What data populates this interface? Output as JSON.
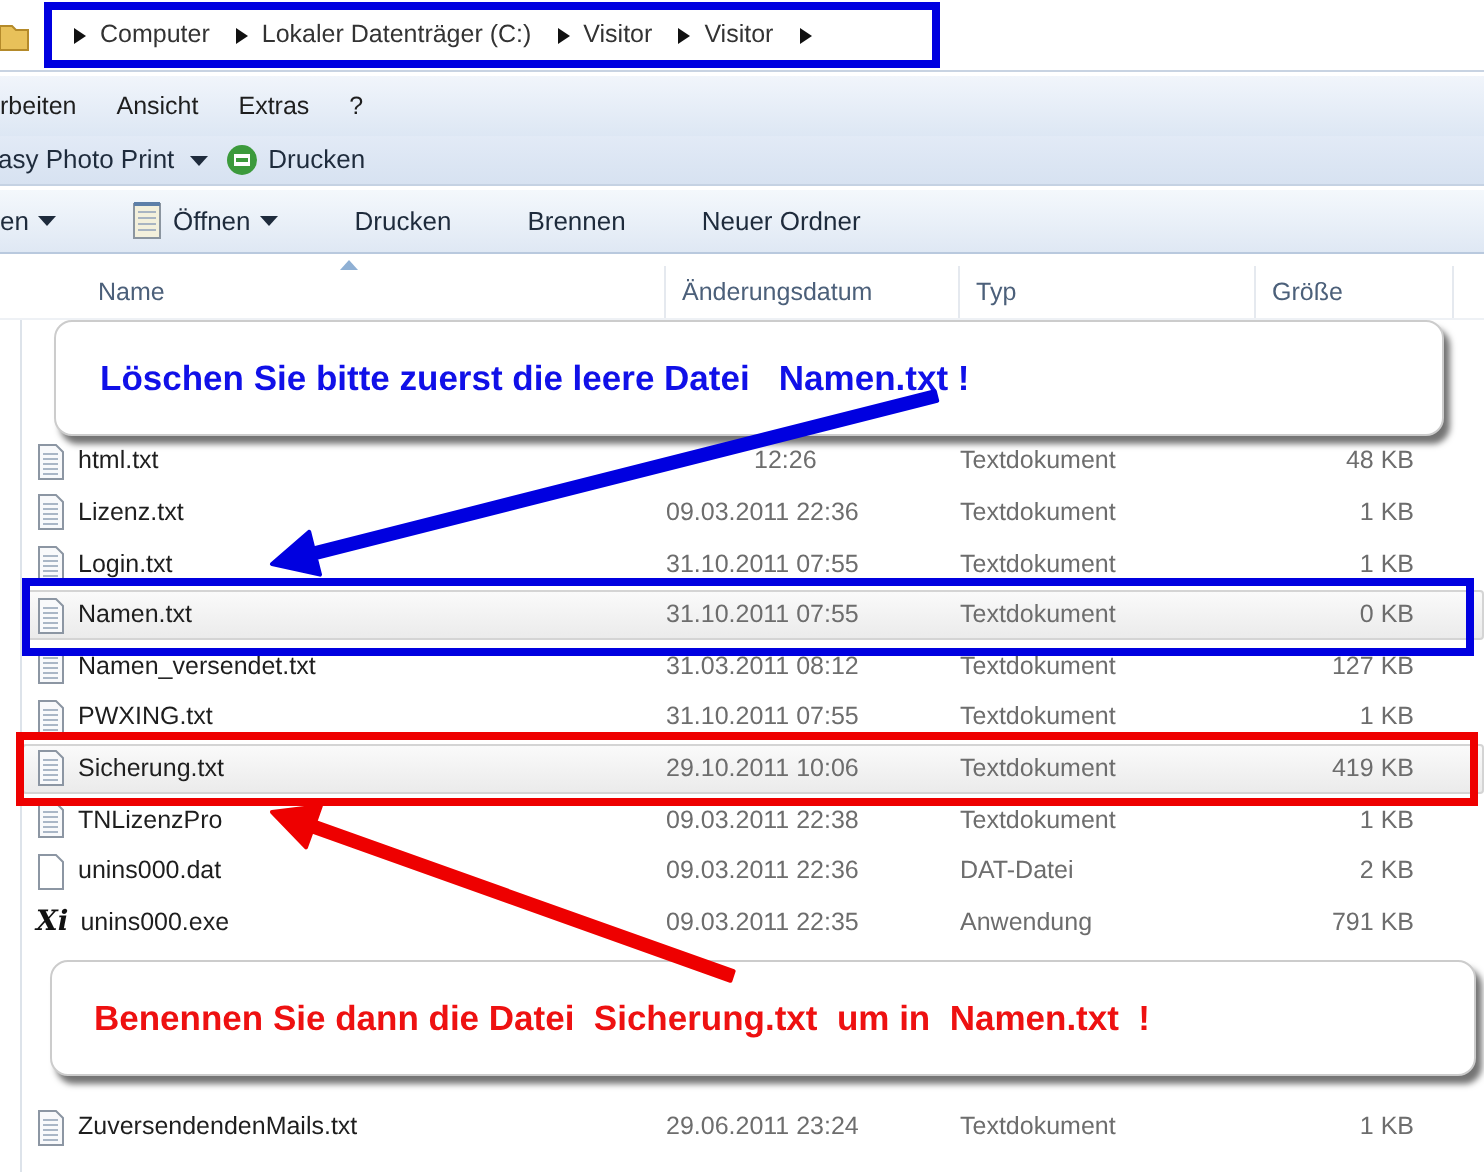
{
  "address_bar": {
    "crumbs": [
      "Computer",
      "Lokaler Datenträger (C:)",
      "Visitor",
      "Visitor"
    ]
  },
  "menu_bar": [
    "rbeiten",
    "Ansicht",
    "Extras",
    "?"
  ],
  "plugin_bar": [
    {
      "label": "asy Photo Print",
      "kind": "dropdown"
    },
    {
      "label": "Drucken",
      "kind": "print"
    }
  ],
  "command_bar": [
    {
      "label": "en",
      "dropdown": true,
      "kind": "plain"
    },
    {
      "label": "Öffnen",
      "dropdown": true,
      "kind": "notepad"
    },
    {
      "label": "Drucken",
      "dropdown": false,
      "kind": "plain"
    },
    {
      "label": "Brennen",
      "dropdown": false,
      "kind": "plain"
    },
    {
      "label": "Neuer Ordner",
      "dropdown": false,
      "kind": "plain"
    }
  ],
  "columns": [
    {
      "label": "Name",
      "sorted": true
    },
    {
      "label": "Änderungsdatum",
      "sorted": false
    },
    {
      "label": "Typ",
      "sorted": false
    },
    {
      "label": "Größe",
      "sorted": false
    }
  ],
  "rows": [
    {
      "name": "html.txt",
      "date": "12:26",
      "type": "Textdokument",
      "size": "48 KB",
      "kind": "text",
      "highlighted": false
    },
    {
      "name": "Lizenz.txt",
      "date": "09.03.2011 22:36",
      "type": "Textdokument",
      "size": "1 KB",
      "kind": "text",
      "highlighted": false
    },
    {
      "name": "Login.txt",
      "date": "31.10.2011 07:55",
      "type": "Textdokument",
      "size": "1 KB",
      "kind": "text",
      "highlighted": false
    },
    {
      "name": "Namen.txt",
      "date": "31.10.2011 07:55",
      "type": "Textdokument",
      "size": "0 KB",
      "kind": "text",
      "highlighted": true
    },
    {
      "name": "Namen_versendet.txt",
      "date": "31.03.2011 08:12",
      "type": "Textdokument",
      "size": "127 KB",
      "kind": "text",
      "highlighted": false
    },
    {
      "name": "PWXING.txt",
      "date": "31.10.2011 07:55",
      "type": "Textdokument",
      "size": "1 KB",
      "kind": "text",
      "highlighted": false
    },
    {
      "name": "Sicherung.txt",
      "date": "29.10.2011 10:06",
      "type": "Textdokument",
      "size": "419 KB",
      "kind": "text",
      "highlighted": true
    },
    {
      "name": "TNLizenzPro",
      "date": "09.03.2011 22:38",
      "type": "Textdokument",
      "size": "1 KB",
      "kind": "text",
      "highlighted": false
    },
    {
      "name": "unins000.dat",
      "date": "09.03.2011 22:36",
      "type": "DAT-Datei",
      "size": "2 KB",
      "kind": "blank",
      "highlighted": false
    },
    {
      "name": "unins000.exe",
      "date": "09.03.2011 22:35",
      "type": "Anwendung",
      "size": "791 KB",
      "kind": "xi",
      "icon_label": "Xi",
      "highlighted": false
    },
    {
      "name": "ZuversendendenMails.txt",
      "date": "29.06.2011 23:24",
      "type": "Textdokument",
      "size": "1 KB",
      "kind": "text",
      "highlighted": false
    }
  ],
  "annotations": {
    "callouts": [
      {
        "text": "Löschen Sie bitte zuerst die leere Datei   Namen.txt !",
        "color": "#1010e8"
      },
      {
        "text": "Benennen Sie dann die Datei  Sicherung.txt  um in  Namen.txt  !",
        "color": "#ee1111"
      }
    ],
    "frames": [
      {
        "color": "#0000e0"
      },
      {
        "color": "#0000e0"
      },
      {
        "color": "#ee0000"
      }
    ],
    "arrows": [
      {
        "color": "#0000e0"
      },
      {
        "color": "#ee0000"
      }
    ]
  }
}
